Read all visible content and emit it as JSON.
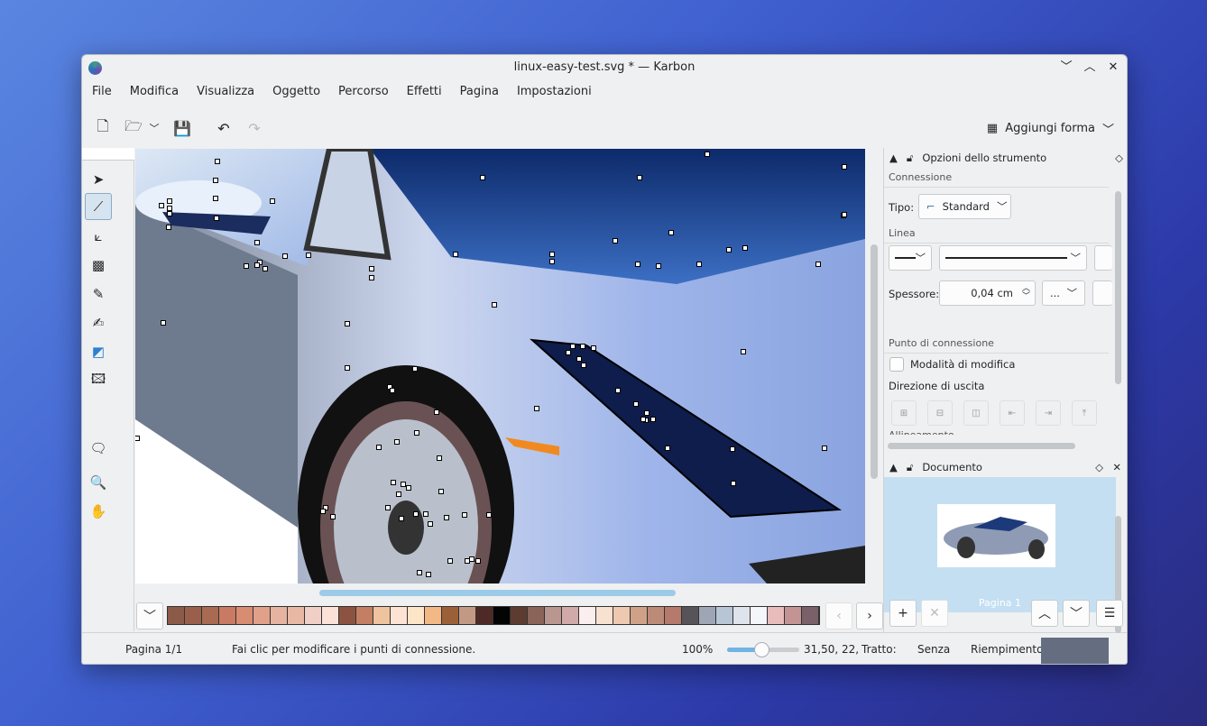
{
  "window": {
    "title": "linux-easy-test.svg * — Karbon",
    "controls": [
      "﹀",
      "︿",
      "✕"
    ]
  },
  "menu": [
    "File",
    "Modifica",
    "Visualizza",
    "Oggetto",
    "Percorso",
    "Effetti",
    "Pagina",
    "Impostazioni"
  ],
  "toolbar": {
    "add_shape": "Aggiungi forma"
  },
  "tool_options": {
    "title": "Opzioni dello strumento",
    "connection_section": "Connessione",
    "type_label": "Tipo:",
    "type_value": "Standard",
    "line_section": "Linea",
    "thickness_label": "Spessore:",
    "thickness_value": "0,04 cm",
    "dash_value": "...",
    "connection_point_section": "Punto di connessione",
    "edit_mode_label": "Modalità di modifica",
    "edit_mode_checked": false,
    "exit_direction_label": "Direzione di uscita",
    "cut_label": "Allineamento"
  },
  "document": {
    "title": "Documento",
    "page_label": "Pagina 1"
  },
  "palette": [
    "#8b5a48",
    "#9a5f4a",
    "#a86a52",
    "#c97a62",
    "#d88c72",
    "#e0a08a",
    "#e5b3a0",
    "#e8b8a5",
    "#f0d0c6",
    "#fbe1d8",
    "#8c5440",
    "#c47e63",
    "#efc39e",
    "#fce3d4",
    "#fde5c8",
    "#f2b886",
    "#9c6038",
    "#c29a84",
    "#4e2a26",
    "#050404",
    "#5c3c30",
    "#8a6458",
    "#b99690",
    "#d1a9a8",
    "#fbeeee",
    "#f7e1d0",
    "#edc9b0",
    "#cfa288",
    "#bc8b78",
    "#b57a6c",
    "#565458",
    "#9ea6b6",
    "#b8c5d5",
    "#dfe3ec",
    "#f4f6fa",
    "#e9bcbc",
    "#c49494",
    "#7a6068"
  ],
  "status": {
    "page": "Pagina 1/1",
    "hint": "Fai clic per modificare i punti di connessione.",
    "zoom": "100%",
    "zoom_level": 0.4,
    "coords": "31,50, 22,",
    "stroke_label": "Tratto:",
    "stroke_value": "Senza",
    "fill_label": "Riempimento:",
    "fill_color": "#646e80"
  }
}
